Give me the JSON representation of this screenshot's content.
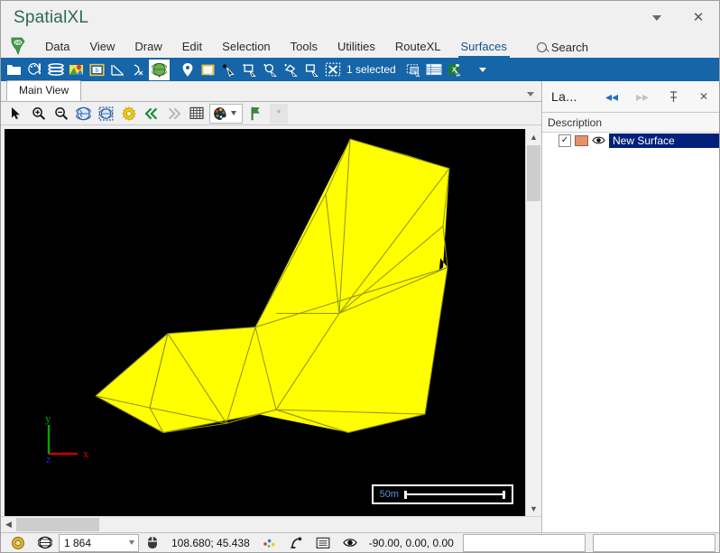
{
  "window": {
    "title": "SpatialXL",
    "minimize_icon": "chevron-down-icon",
    "close_icon": "close-icon"
  },
  "menubar": {
    "logo_icon": "app-logo-africa-icon",
    "items": [
      {
        "label": "Data",
        "active": false
      },
      {
        "label": "View",
        "active": false
      },
      {
        "label": "Draw",
        "active": false
      },
      {
        "label": "Edit",
        "active": false
      },
      {
        "label": "Selection",
        "active": false
      },
      {
        "label": "Tools",
        "active": false
      },
      {
        "label": "Utilities",
        "active": false
      },
      {
        "label": "RouteXL",
        "active": false
      },
      {
        "label": "Surfaces",
        "active": true
      }
    ],
    "search": {
      "label": "Search",
      "icon": "search-icon"
    }
  },
  "toolbar": {
    "background": "#1565a8",
    "selection_status": "1 selected",
    "icons": [
      "open-folder-icon",
      "palette-style-icon",
      "layers-icon",
      "basemap-icon",
      "raster-image-icon",
      "measure-angle-icon",
      "snap-node-icon",
      "globe-3d-icon",
      "place-marker-icon",
      "annotation-note-icon",
      "select-point-icon",
      "select-rectangle-icon",
      "select-circle-icon",
      "select-polygon-icon",
      "select-box-remove-icon",
      "clear-selection-icon"
    ],
    "after_icons": [
      "select-by-attribute-icon",
      "attribute-table-icon",
      "export-excel-icon"
    ],
    "overflow_icon": "chevron-down-icon"
  },
  "view_tabs": {
    "tabs": [
      {
        "label": "Main View",
        "active": true
      }
    ],
    "overflow_icon": "chevron-down-icon"
  },
  "view_toolbar": {
    "icons": [
      "pointer-select-icon",
      "zoom-in-icon",
      "zoom-out-icon",
      "zoom-extents-icon",
      "zoom-selection-icon",
      "view-settings-gear-icon",
      "rewind-icon",
      "forward-icon",
      "grid-icon",
      "color-palette-icon",
      "bookmark-flag-icon"
    ],
    "more_label": "*"
  },
  "canvas": {
    "background": "#000000",
    "surface_color": "#FFFF00",
    "wireframe_color": "#808000",
    "scalebar": {
      "label": "50m",
      "text_color": "#5b8fd6"
    },
    "axes": [
      {
        "name": "x",
        "color": "#cc0000"
      },
      {
        "name": "y",
        "color": "#00aa00"
      },
      {
        "name": "z",
        "color": "#0000dd"
      }
    ],
    "vscroll": {
      "up_icon": "chevron-up-icon",
      "down_icon": "chevron-down-icon"
    },
    "hscroll": {
      "left_icon": "chevron-left-icon",
      "right_icon": "chevron-right-icon"
    }
  },
  "right_panel": {
    "title": "La...",
    "prev_icon": "double-arrow-left-icon",
    "next_icon": "double-arrow-right-icon",
    "pin_icon": "pin-icon",
    "close_icon": "close-icon",
    "column_header": "Description",
    "rows": [
      {
        "label": "New Surface",
        "checked": true,
        "check_glyph": "✓",
        "swatch_color": "#e8906a",
        "visibility_icon": "eye-icon",
        "selected": true,
        "selection_color": "#00207a"
      }
    ]
  },
  "statusbar": {
    "lock_icon": "padlock-gold-icon",
    "globe_icon": "globe-icon",
    "scale_value": "1 864",
    "mouse_icon": "mouse-icon",
    "coordinates": "108.680; 45.438",
    "snap_icon": "snap-points-icon",
    "units_icon": "angle-unit-icon",
    "table_icon": "table-icon",
    "rotation_icon": "eye-rotation-icon",
    "rotation_values": "-90.00, 0.00, 0.00"
  }
}
